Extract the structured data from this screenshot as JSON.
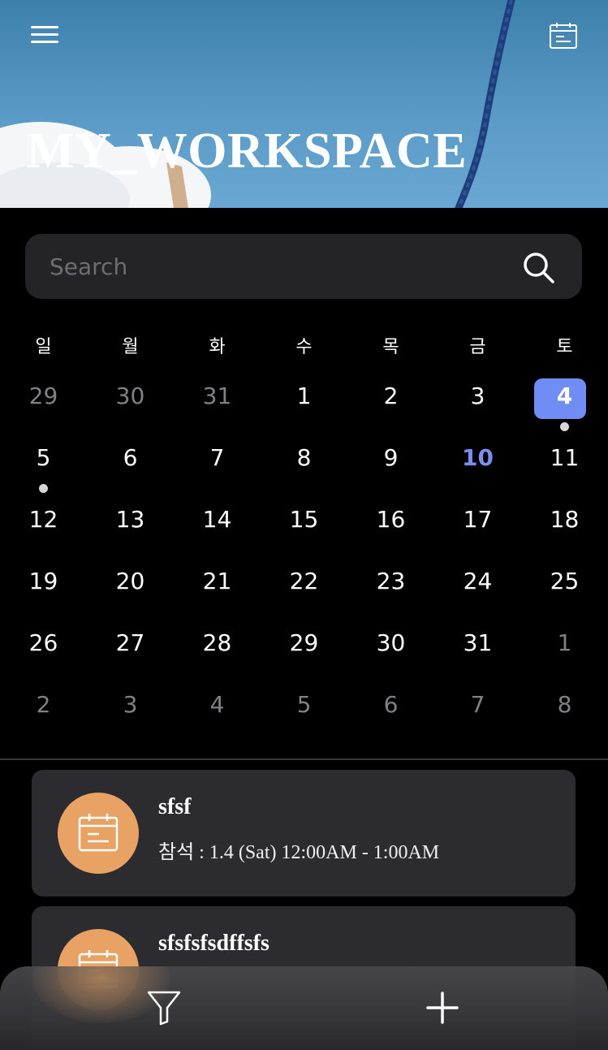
{
  "header": {
    "title": "MY_WORKSPACE",
    "menu_icon": "hamburger-menu-icon",
    "calendar_icon": "calendar-icon"
  },
  "search": {
    "placeholder": "Search",
    "icon": "search-icon"
  },
  "calendar": {
    "weekdays": [
      "일",
      "월",
      "화",
      "수",
      "목",
      "금",
      "토"
    ],
    "weeks": [
      [
        "29",
        "30",
        "31",
        "1",
        "2",
        "3",
        "4"
      ],
      [
        "5",
        "6",
        "7",
        "8",
        "9",
        "10",
        "11"
      ],
      [
        "12",
        "13",
        "14",
        "15",
        "16",
        "17",
        "18"
      ],
      [
        "19",
        "20",
        "21",
        "22",
        "23",
        "24",
        "25"
      ],
      [
        "26",
        "27",
        "28",
        "29",
        "30",
        "31",
        "1"
      ],
      [
        "2",
        "3",
        "4",
        "5",
        "6",
        "7",
        "8"
      ]
    ],
    "selected_day": "4",
    "today_day": "10",
    "event_dot_days": [
      "4",
      "5"
    ]
  },
  "events": [
    {
      "title": "sfsf",
      "time": "참석 : 1.4 (Sat) 12:00AM - 1:00AM",
      "icon": "calendar-icon"
    },
    {
      "title": "sfsfsfsdffsfs",
      "icon": "calendar-icon"
    }
  ],
  "bottom_bar": {
    "filter_icon": "filter-icon",
    "add_icon": "plus-icon"
  },
  "colors": {
    "accent": "#6f8df5",
    "today": "#7b8ff0",
    "event_avatar": "#e8a364",
    "card_bg": "#2c2c30",
    "search_bg": "#242427"
  }
}
